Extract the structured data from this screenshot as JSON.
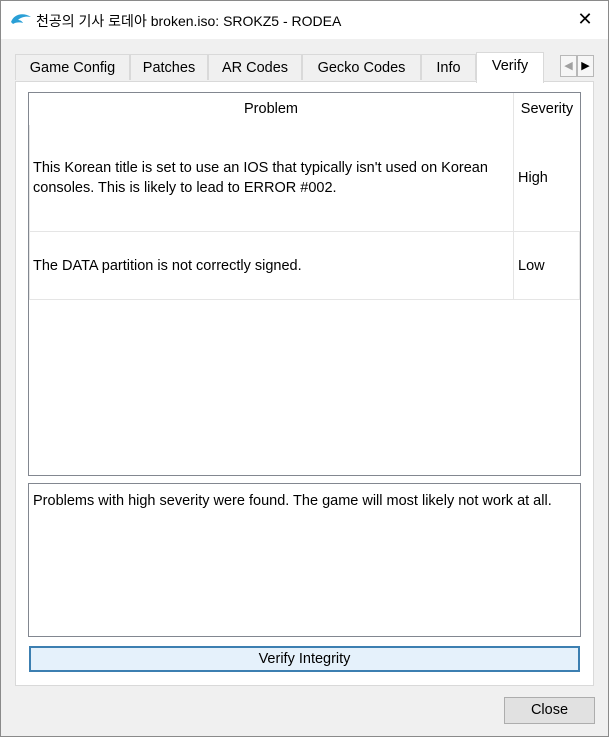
{
  "window": {
    "title": "천공의 기사 로데아 broken.iso: SROKZ5 - RODEA",
    "close_glyph": "✕",
    "icon": "dolphin-icon"
  },
  "tabs": [
    {
      "label": "Game Config"
    },
    {
      "label": "Patches"
    },
    {
      "label": "AR Codes"
    },
    {
      "label": "Gecko Codes"
    },
    {
      "label": "Info"
    },
    {
      "label": "Verify",
      "active": true
    }
  ],
  "tab_scroll": {
    "left_glyph": "◀",
    "right_glyph": "▶"
  },
  "problems_table": {
    "columns": [
      "Problem",
      "Severity"
    ],
    "rows": [
      {
        "problem": "This Korean title is set to use an IOS that typically isn't used on Korean consoles. This is likely to lead to ERROR #002.",
        "severity": "High"
      },
      {
        "problem": "The DATA partition is not correctly signed.",
        "severity": "Low"
      }
    ]
  },
  "summary": "Problems with high severity were found. The game will most likely not work at all.",
  "buttons": {
    "verify": "Verify Integrity",
    "close": "Close"
  },
  "colors": {
    "focus_border": "#3c7fb1",
    "focus_fill": "#e5f1fb",
    "dolphin": "#2a9fd6"
  }
}
